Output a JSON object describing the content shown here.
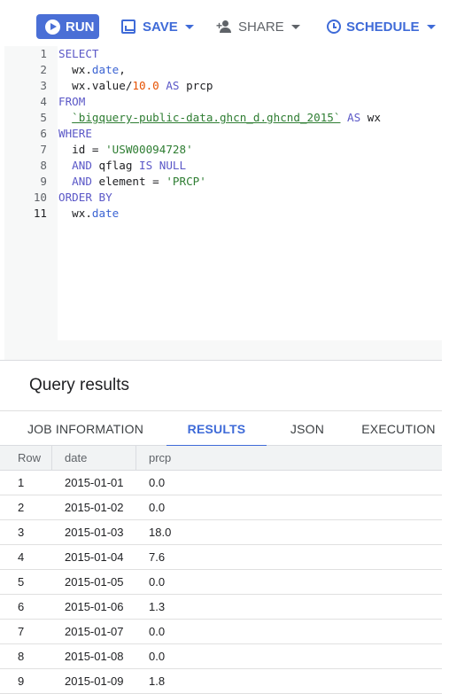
{
  "toolbar": {
    "run_label": "RUN",
    "save_label": "SAVE",
    "share_label": "SHARE",
    "schedule_label": "SCHEDULE"
  },
  "editor": {
    "active_line": 11,
    "lines": [
      {
        "n": "1",
        "tokens": [
          {
            "t": "SELECT",
            "c": "kw"
          }
        ]
      },
      {
        "n": "2",
        "tokens": [
          {
            "t": "  wx.",
            "c": ""
          },
          {
            "t": "date",
            "c": "fn"
          },
          {
            "t": ",",
            "c": ""
          }
        ]
      },
      {
        "n": "3",
        "tokens": [
          {
            "t": "  wx.value/",
            "c": ""
          },
          {
            "t": "10.0",
            "c": "num"
          },
          {
            "t": " AS",
            "c": "kw"
          },
          {
            "t": " prcp",
            "c": ""
          }
        ]
      },
      {
        "n": "4",
        "tokens": [
          {
            "t": "FROM",
            "c": "kw"
          }
        ]
      },
      {
        "n": "5",
        "tokens": [
          {
            "t": "  ",
            "c": ""
          },
          {
            "t": "`bigquery-public-data.ghcn_d.ghcnd_2015`",
            "c": "tbl"
          },
          {
            "t": " AS",
            "c": "kw"
          },
          {
            "t": " wx",
            "c": ""
          }
        ]
      },
      {
        "n": "6",
        "tokens": [
          {
            "t": "WHERE",
            "c": "kw"
          }
        ]
      },
      {
        "n": "7",
        "tokens": [
          {
            "t": "  id = ",
            "c": ""
          },
          {
            "t": "'USW00094728'",
            "c": "str"
          }
        ]
      },
      {
        "n": "8",
        "tokens": [
          {
            "t": "  AND",
            "c": "kw"
          },
          {
            "t": " qflag ",
            "c": ""
          },
          {
            "t": "IS NULL",
            "c": "kw"
          }
        ]
      },
      {
        "n": "9",
        "tokens": [
          {
            "t": "  AND",
            "c": "kw"
          },
          {
            "t": " element = ",
            "c": ""
          },
          {
            "t": "'PRCP'",
            "c": "str"
          }
        ]
      },
      {
        "n": "10",
        "tokens": [
          {
            "t": "ORDER BY",
            "c": "kw"
          }
        ]
      },
      {
        "n": "11",
        "tokens": [
          {
            "t": "  wx.",
            "c": ""
          },
          {
            "t": "date",
            "c": "fn"
          }
        ]
      }
    ]
  },
  "results": {
    "title": "Query results",
    "tabs": [
      "JOB INFORMATION",
      "RESULTS",
      "JSON",
      "EXECUTION"
    ],
    "active_tab": "RESULTS",
    "columns": [
      "Row",
      "date",
      "prcp"
    ],
    "rows": [
      [
        "1",
        "2015-01-01",
        "0.0"
      ],
      [
        "2",
        "2015-01-02",
        "0.0"
      ],
      [
        "3",
        "2015-01-03",
        "18.0"
      ],
      [
        "4",
        "2015-01-04",
        "7.6"
      ],
      [
        "5",
        "2015-01-05",
        "0.0"
      ],
      [
        "6",
        "2015-01-06",
        "1.3"
      ],
      [
        "7",
        "2015-01-07",
        "0.0"
      ],
      [
        "8",
        "2015-01-08",
        "0.0"
      ],
      [
        "9",
        "2015-01-09",
        "1.8"
      ]
    ]
  },
  "colors": {
    "accent": "#3f6bd8",
    "run_button": "#4a6fd6",
    "keyword": "#5a57c7",
    "string": "#2e7d32",
    "number": "#e65100"
  }
}
